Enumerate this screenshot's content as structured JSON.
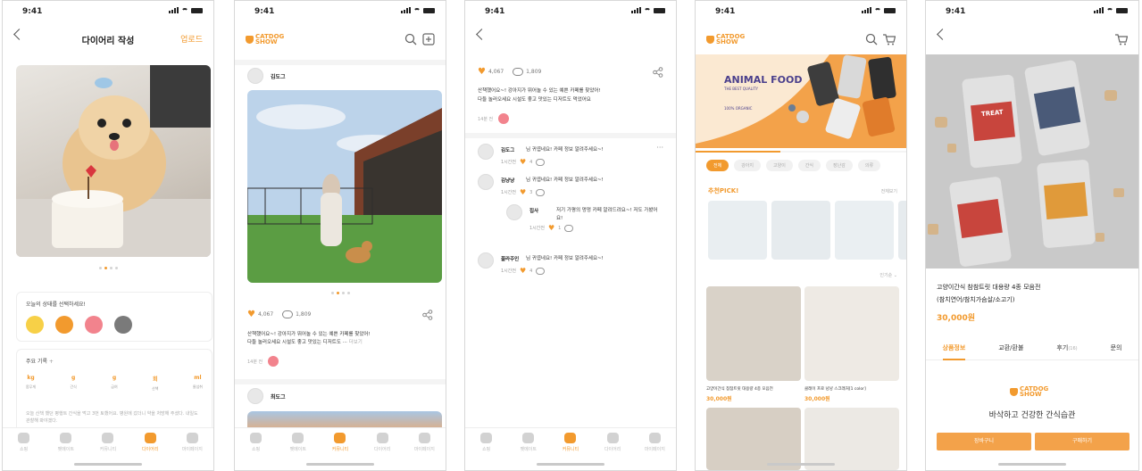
{
  "status_time": "9:41",
  "tabs": [
    "쇼핑",
    "펫메이트",
    "커뮤니티",
    "다이어리",
    "마이페이지"
  ],
  "screen1": {
    "title": "다이어리 작성",
    "upload": "업로드",
    "mood_prompt": "오늘의 상태를 선택하세요!",
    "record_title": "주요 기록",
    "record_add": "+",
    "metrics": [
      {
        "value": "kg",
        "label": "몸무게"
      },
      {
        "value": "g",
        "label": "간식"
      },
      {
        "value": "g",
        "label": "급여"
      },
      {
        "value": "회",
        "label": "산책"
      },
      {
        "value": "ml",
        "label": "물섭취"
      }
    ],
    "note": "오늘 산책 했던 평행트 간식을 먹고 3번 토했어요. 병원에 갔더니 약을 처방해 주셨다. 내일도 관찰해 봐야겠다.",
    "colors": {
      "accent": "#f29a2e"
    }
  },
  "screen2": {
    "post1_user": "김도그",
    "likes": "4,067",
    "comments": "1,809",
    "caption": "산책했어요~! 강아지가 뛰어놀 수 있는 예쁜 카페를 찾았어!\n다들 놀러오세요 시설도 좋고 맛있는 디저트도 ···",
    "more": "더보기",
    "time": "14분 전",
    "post2_user": "최도그"
  },
  "screen3": {
    "likes": "4,067",
    "comments": "1,809",
    "caption": "산책했어요~! 강아지가 뛰어놀 수 있는 예쁜 카페를 찾았어!\n다들 놀러오세요 시설도 좋고 맛있는 디저트도 먹었어요",
    "time": "14분 전",
    "thread": [
      {
        "user": "김도그",
        "text": "님 귀엽네요! 카페 정보 알려주세요~!",
        "time": "1시간전",
        "likes": "4",
        "reply": false,
        "more": "···"
      },
      {
        "user": "김냥냥",
        "text": "님 귀엽네요! 카페 정보 알려주세요~!",
        "time": "1시간전",
        "likes": "3",
        "reply": false,
        "more": ""
      },
      {
        "user": "집사",
        "text": "저기 가평의 멍멍 카페 알려드려요~! 저도 가봤어요!",
        "time": "1시간전",
        "likes": "1",
        "reply": true,
        "more": ""
      },
      {
        "user": "꼴라주인",
        "text": "님 귀엽네요! 카페 정보 알려주세요~!",
        "time": "1시간전",
        "likes": "4",
        "reply": false,
        "more": ""
      }
    ]
  },
  "screen4": {
    "banner_title": "ANIMAL FOOD",
    "banner_sub": "THE BEST QUALITY",
    "banner_tag": "100% ORGANIC",
    "categories": [
      "전체",
      "강아지",
      "고양이",
      "간식",
      "장난감",
      "의류"
    ],
    "pick_title": "추천PICK!",
    "pick_more": "전체보기",
    "sort": "인기순",
    "products": [
      {
        "name": "고양이간식 참참트릿 대용량 4종 모음전",
        "price": "30,000원"
      },
      {
        "name": "클레이 프로 냥냥 스크래처[1 color]",
        "price": "30,000원"
      }
    ]
  },
  "screen5": {
    "product_name": "고양이간식 참참트릿 대용량 4종 모음전",
    "product_sub": "(참치연어/참치가슴살/소고기)",
    "price": "30,000원",
    "tabs": [
      "상품정보",
      "교환/환불",
      "후기",
      "문의"
    ],
    "review_count": "(16)",
    "logo_top": "CATDOG",
    "logo_bottom": "SHOW",
    "headline": "바삭하고 건강한 간식습관",
    "cart_btn": "장바구니",
    "buy_btn": "구매하기",
    "jar_label": "TREAT"
  },
  "brand_top": "CATDOG",
  "brand_bottom": "SHOW"
}
